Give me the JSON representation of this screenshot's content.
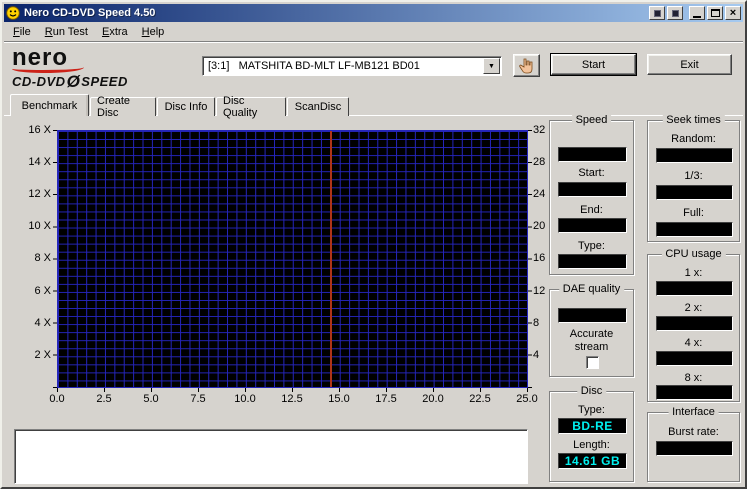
{
  "window": {
    "title": "Nero CD-DVD Speed 4.50"
  },
  "icons": {
    "app_icon": "smiley",
    "minimize": "_",
    "maximize": "restore-square",
    "close": "x",
    "combo_arrow": "chevron-down",
    "drive_action": "hand-pointer"
  },
  "menu": {
    "items": [
      {
        "hot": "F",
        "rest": "ile"
      },
      {
        "hot": "R",
        "rest": "un Test"
      },
      {
        "hot": "E",
        "rest": "xtra"
      },
      {
        "hot": "H",
        "rest": "elp"
      }
    ]
  },
  "logo": {
    "brand": "nero",
    "line2_left": "CD-DVD",
    "line2_symbol": "Ø",
    "line2_right": "SPEED"
  },
  "toolbar": {
    "drive_selector": "[3:1]   MATSHITA BD-MLT LF-MB121 BD01",
    "start_label": "Start",
    "exit_label": "Exit"
  },
  "tabs": [
    {
      "label": "Benchmark",
      "active": true
    },
    {
      "label": "Create Disc",
      "active": false
    },
    {
      "label": "Disc Info",
      "active": false
    },
    {
      "label": "Disc Quality",
      "active": false
    },
    {
      "label": "ScanDisc",
      "active": false
    }
  ],
  "chart_data": {
    "type": "line",
    "title": "",
    "x_ticks": [
      "0.0",
      "2.5",
      "5.0",
      "7.5",
      "10.0",
      "12.5",
      "15.0",
      "17.5",
      "20.0",
      "22.5",
      "25.0"
    ],
    "y_left_ticks": [
      "16 X",
      "14 X",
      "12 X",
      "10 X",
      "8 X",
      "6 X",
      "4 X",
      "2 X"
    ],
    "y_right_ticks": [
      "32",
      "28",
      "24",
      "20",
      "16",
      "12",
      "8",
      "4"
    ],
    "x_range": [
      0,
      25
    ],
    "y_left_range": [
      0,
      16
    ],
    "y_right_range": [
      0,
      32
    ],
    "series": [],
    "cursor_x": 14.5,
    "grid": true,
    "plot_bg": "#000000",
    "grid_color": "#2525bb",
    "cursor_color": "#b03418"
  },
  "panels": {
    "speed": {
      "title": "Speed",
      "current_value": "",
      "start_label": "Start:",
      "start_value": "",
      "end_label": "End:",
      "end_value": "",
      "type_label": "Type:",
      "type_value": ""
    },
    "seek_times": {
      "title": "Seek times",
      "random_label": "Random:",
      "random_value": "",
      "third_label": "1/3:",
      "third_value": "",
      "full_label": "Full:",
      "full_value": ""
    },
    "cpu_usage": {
      "title": "CPU usage",
      "labels": [
        "1 x:",
        "2 x:",
        "4 x:",
        "8 x:"
      ],
      "values": [
        "",
        "",
        "",
        ""
      ]
    },
    "dae_quality": {
      "title": "DAE quality",
      "score_value": "",
      "accurate_stream_label": "Accurate stream",
      "accurate_stream_checked": false
    },
    "disc": {
      "title": "Disc",
      "type_label": "Type:",
      "type_value": "BD-RE",
      "length_label": "Length:",
      "length_value": "14.61 GB"
    },
    "interface": {
      "title": "Interface",
      "burst_label": "Burst rate:",
      "burst_value": ""
    }
  },
  "colors": {
    "titlebar_left": "#0a246a",
    "titlebar_right": "#a6caf0",
    "chrome": "#d6d3ce",
    "value_text": "#00f0f0",
    "logo_swoosh": "#cc2218"
  }
}
